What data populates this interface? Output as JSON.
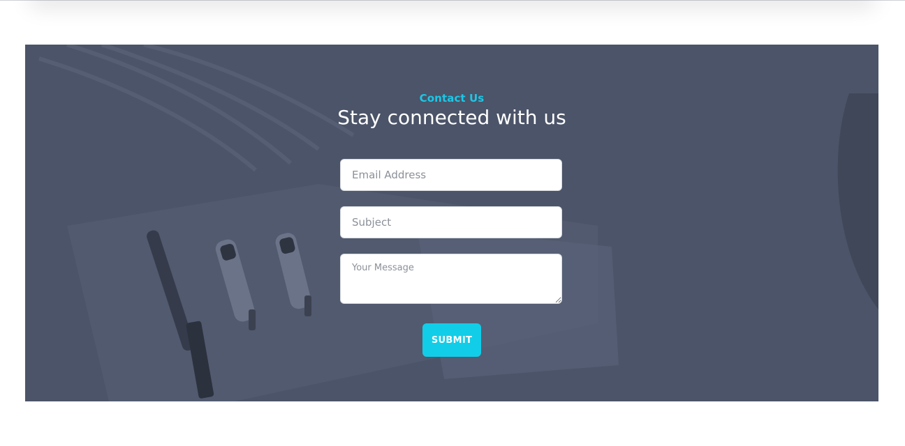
{
  "colors": {
    "accent": "#1cc7e6",
    "button": "#12cde8",
    "overlay": "#4b5468",
    "heading": "#ffffff"
  },
  "contact": {
    "eyebrow": "Contact Us",
    "heading": "Stay connected with us"
  },
  "form": {
    "email_placeholder": "Email Address",
    "email_value": "",
    "subject_placeholder": "Subject",
    "subject_value": "",
    "message_placeholder": "Your Message",
    "message_value": "",
    "submit_label": "SUBMIT"
  },
  "background": {
    "icon": "dental-tools-photo"
  }
}
